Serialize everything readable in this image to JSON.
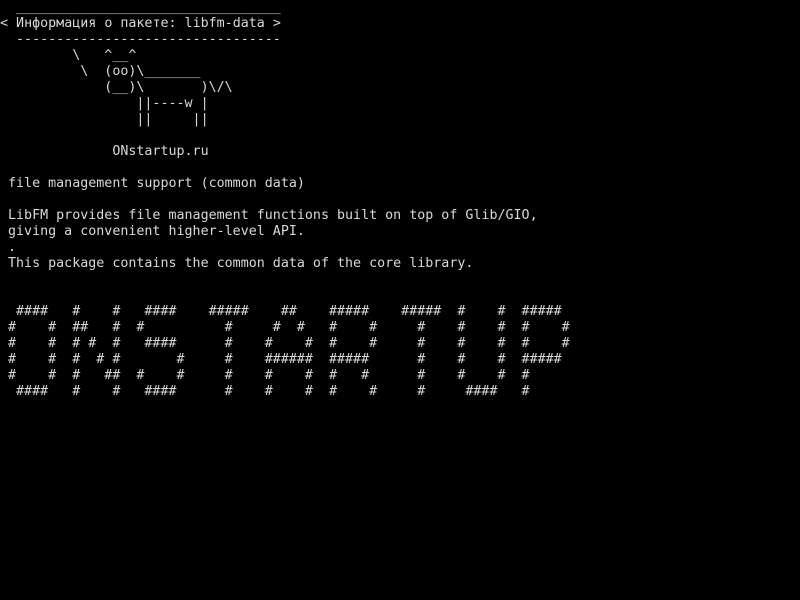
{
  "screen": {
    "foreground": "#d8d8d8",
    "background": "#000000"
  },
  "cowsay": {
    "top_border": " _________________________________",
    "message": "< Информация о пакете: libfm-data >",
    "bottom_border": " ---------------------------------",
    "cow": [
      "        \\   ^__^",
      "         \\  (oo)\\_______",
      "            (__)\\       )\\/\\",
      "                ||----w |",
      "                ||     ||"
    ]
  },
  "site": "             ONstartup.ru",
  "package": {
    "summary": "file management support (common data)",
    "description": [
      "LibFM provides file management functions built on top of Glib/GIO,",
      "giving a convenient higher-level API.",
      ".",
      "This package contains the common data of the core library."
    ]
  },
  "banner": [
    " ####   #    #   ####    #####    ##    #####    #####  #    #  #####",
    "#    #  ##   #  #          #     #  #   #    #     #    #    #  #    #",
    "#    #  # #  #   ####      #    #    #  #    #     #    #    #  #    #",
    "#    #  #  # #       #     #    ######  #####      #    #    #  #####",
    "#    #  #   ##  #    #     #    #    #  #   #      #    #    #  #",
    " ####   #    #   ####      #    #    #  #    #     #     ####   #"
  ]
}
